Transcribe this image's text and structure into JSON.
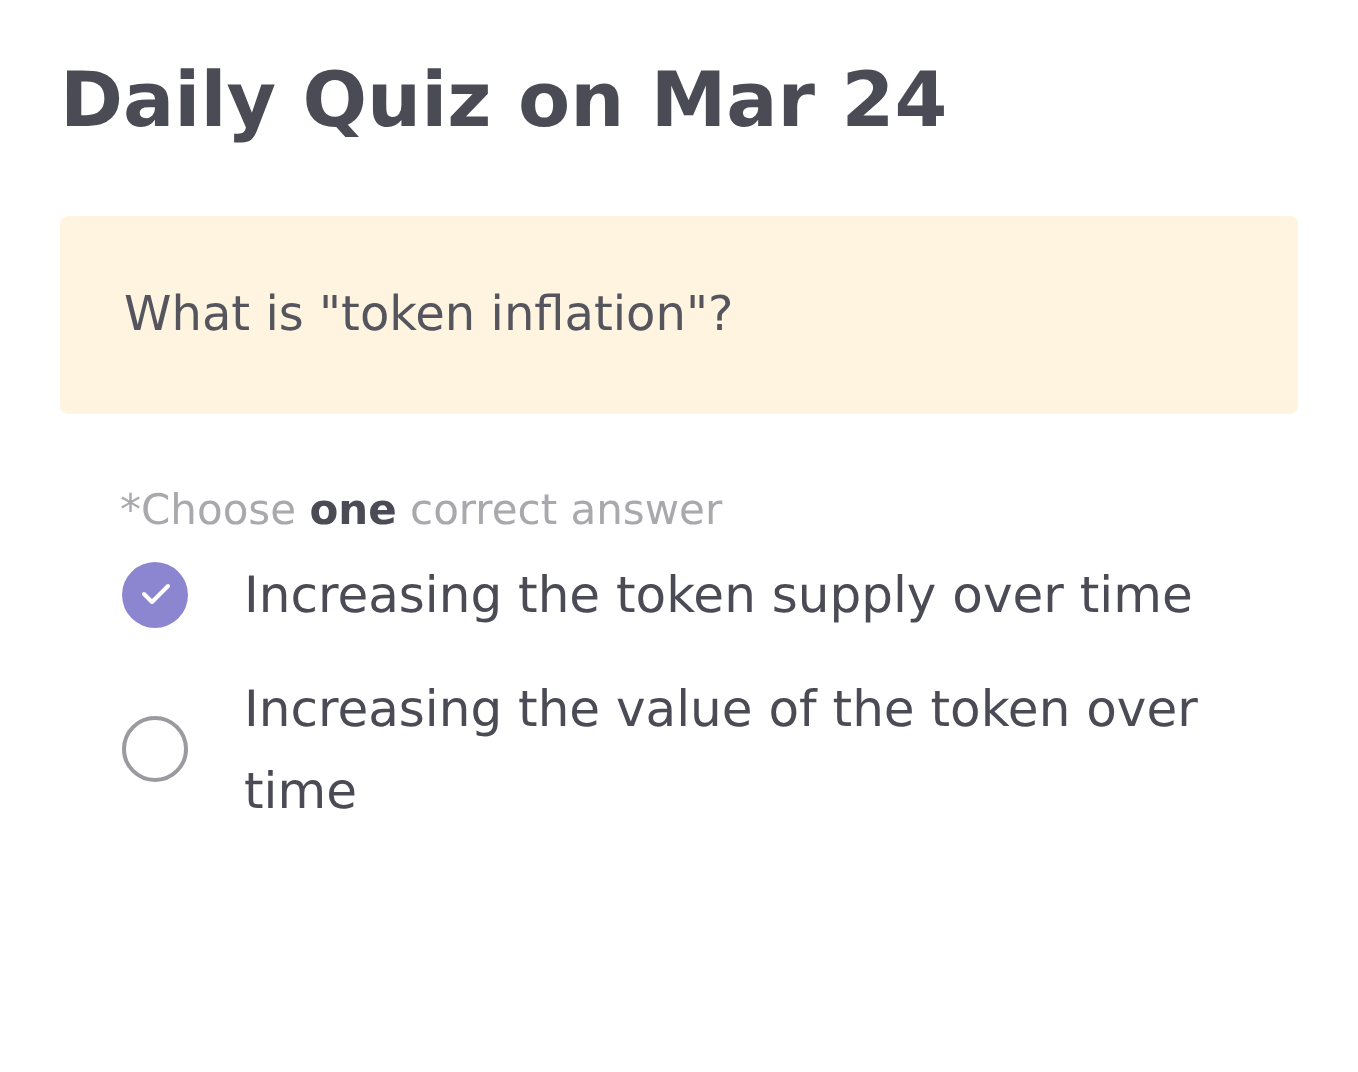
{
  "title": "Daily Quiz on Mar 24",
  "question": "What is \"token inflation\"?",
  "instruction": "*Choose **one** correct answer",
  "options": [
    {
      "label": "Increasing the token supply over time",
      "selected": true
    },
    {
      "label": "Increasing the value of the token over time",
      "selected": false
    }
  ]
}
